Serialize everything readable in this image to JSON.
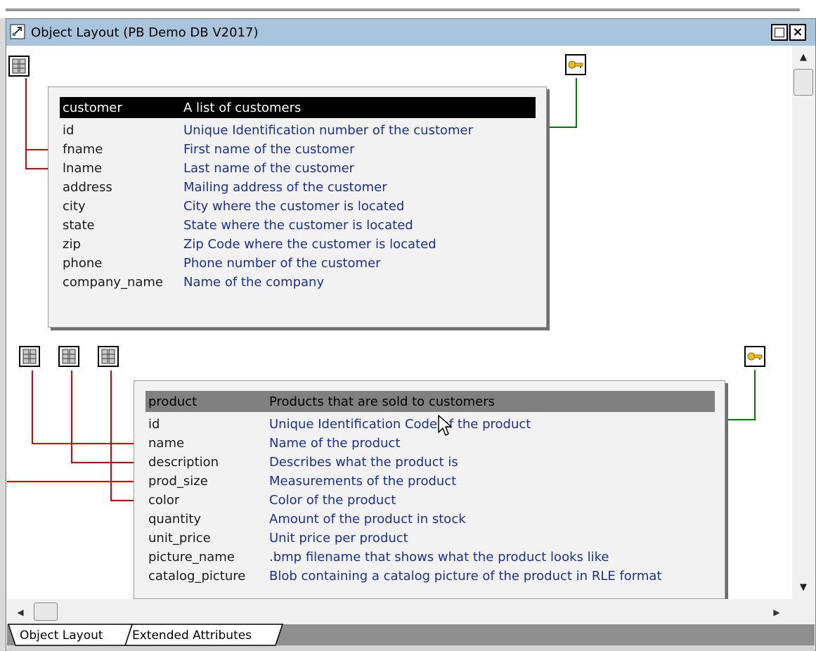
{
  "window": {
    "title": "Object Layout (PB Demo DB V2017)",
    "restore_glyph": "□",
    "close_glyph": "×"
  },
  "tables": [
    {
      "name": "customer",
      "description": "A list of customers",
      "columns": [
        {
          "name": "id",
          "description": "Unique Identification number of the customer"
        },
        {
          "name": "fname",
          "description": "First name of the customer"
        },
        {
          "name": "lname",
          "description": "Last name of the customer"
        },
        {
          "name": "address",
          "description": "Mailing address of the customer"
        },
        {
          "name": "city",
          "description": "City where the customer is located"
        },
        {
          "name": "state",
          "description": "State where the customer is located"
        },
        {
          "name": "zip",
          "description": "Zip Code where the customer is located"
        },
        {
          "name": "phone",
          "description": "Phone number of the customer"
        },
        {
          "name": "company_name",
          "description": "Name of the company"
        }
      ]
    },
    {
      "name": "product",
      "description": "Products that are sold to customers",
      "columns": [
        {
          "name": "id",
          "description": "Unique Identification Code of the product"
        },
        {
          "name": "name",
          "description": "Name of the product"
        },
        {
          "name": "description",
          "description": "Describes what the product is"
        },
        {
          "name": "prod_size",
          "description": "Measurements of the product"
        },
        {
          "name": "color",
          "description": "Color of the product"
        },
        {
          "name": "quantity",
          "description": "Amount of the product in stock"
        },
        {
          "name": "unit_price",
          "description": "Unit price per product"
        },
        {
          "name": "picture_name",
          "description": ".bmp filename that shows what the product looks like"
        },
        {
          "name": "catalog_picture",
          "description": "Blob containing a catalog picture of the product in RLE format"
        }
      ]
    }
  ],
  "scroll": {
    "up_arrow": "▲",
    "down_arrow": "▼",
    "left_arrow": "◀",
    "right_arrow": "▶"
  },
  "tabs": [
    {
      "label": "Object Layout",
      "active": true
    },
    {
      "label": "Extended Attributes",
      "active": false
    }
  ],
  "colors": {
    "title_bar": "#a9c4dd",
    "customer_header": "#000000",
    "product_header": "#808080",
    "description_text": "#1c2f9f",
    "relation_line": "#e00000",
    "key_line": "#008000",
    "key_icon": "#e8c020"
  },
  "icons": {
    "title": "object-layout-icon",
    "index": "index-icon",
    "key": "primary-key-icon"
  }
}
